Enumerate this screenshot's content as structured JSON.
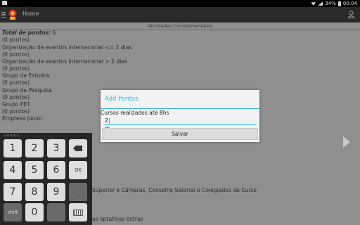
{
  "status_bar": {
    "battery": "34%",
    "time": "00:04"
  },
  "action_bar": {
    "title": "Home"
  },
  "content": {
    "section_title": "Atividades Complementares",
    "total_label": "Total de pontos:",
    "total_value": "6",
    "lines": [
      "(0 pontos)",
      "Organização de eventos internacional <= 2 dias",
      "(0 pontos)",
      "Organização de eventos internacional > 2 dias",
      "(0 pontos)",
      "Grupo de Estudos",
      "(0 pontos)",
      "Grupo de Pesquisa",
      "(0 pontos)",
      "Grupo PET",
      "(0 pontos)",
      "Empresa Júnior"
    ],
    "lower_lines": [
      "Superior e Câmaras, Conselho Setorial e Colegiados de Curso",
      "as optativas extras"
    ]
  },
  "dialog": {
    "title": "Add Pontos",
    "label": "Cursos realizados até 8hs",
    "input_value": "2",
    "save_label": "Salvar"
  },
  "keyboard": {
    "keys": [
      "1",
      "2",
      "3",
      "4",
      "5",
      "6",
      "7",
      "8",
      "9",
      "0"
    ],
    "ok_label": "OK",
    "dot_label": ".",
    "shift_label": "shift"
  },
  "colors": {
    "accent": "#33b5e5",
    "dim_background": "#8f8f8f",
    "keyboard_bg": "#262626"
  },
  "icons": [
    "menu-icon",
    "app-logo",
    "account-icon",
    "next-arrow-icon",
    "backspace-icon",
    "keyboard-hide-icon"
  ]
}
